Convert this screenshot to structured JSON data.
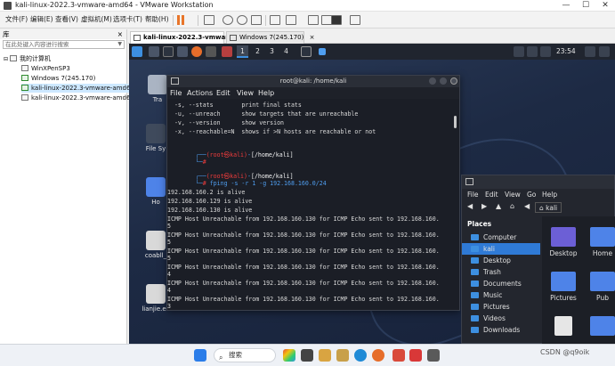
{
  "window": {
    "title": "kali-linux-2022.3-vmware-amd64 - VMware Workstation",
    "minimize": "—",
    "maximize": "☐",
    "close": "✕"
  },
  "menubar": [
    "文件(F)",
    "编辑(E)",
    "查看(V)",
    "虚拟机(M)",
    "选项卡(T)",
    "帮助(H)"
  ],
  "library": {
    "header": "库",
    "close": "×",
    "search_placeholder": "在此处键入内容进行搜索",
    "root": "我的计算机",
    "vms": [
      {
        "name": "WinXPenSP3",
        "running": false
      },
      {
        "name": "Windows 7(245.170)",
        "running": true
      },
      {
        "name": "kali-linux-2022.3-vmware-amd64",
        "running": true,
        "selected": true
      },
      {
        "name": "kali-linux-2022.3-vmware-amd64",
        "running": false
      }
    ]
  },
  "tabs": [
    {
      "label": "kali-linux-2022.3-vmwar...",
      "close": "×",
      "active": true
    },
    {
      "label": "Windows 7(245.170)",
      "close": "×",
      "active": false
    }
  ],
  "kali_panel": {
    "workspaces": [
      "1",
      "2",
      "3",
      "4"
    ],
    "active_workspace": "1",
    "clock": "23:54"
  },
  "desktop_icons": [
    "Tra",
    "File Sy",
    "Ho",
    "coabll_",
    "lianjie.ex"
  ],
  "terminal": {
    "title": "root@kali: /home/kali",
    "menu": [
      "File",
      "Actions",
      "Edit",
      "View",
      "Help"
    ],
    "lines": [
      "  -s, --stats        print final stats",
      "  -u, --unreach      show targets that are unreachable",
      "  -v, --version      show version",
      "  -x, --reachable=N  shows if >N hosts are reachable or not",
      "",
      "",
      "",
      "",
      "",
      "192.168.160.2 is alive",
      "192.168.160.129 is alive",
      "192.168.160.130 is alive",
      "ICMP Host Unreachable from 192.168.160.130 for ICMP Echo sent to 192.168.160.",
      "5",
      "ICMP Host Unreachable from 192.168.160.130 for ICMP Echo sent to 192.168.160.",
      "5",
      "ICMP Host Unreachable from 192.168.160.130 for ICMP Echo sent to 192.168.160.",
      "5",
      "ICMP Host Unreachable from 192.168.160.130 for ICMP Echo sent to 192.168.160.",
      "4",
      "ICMP Host Unreachable from 192.168.160.130 for ICMP Echo sent to 192.168.160.",
      "4",
      "ICMP Host Unreachable from 192.168.160.130 for ICMP Echo sent to 192.168.160.",
      "3",
      "ICMP Host Unreachable from 192.168.160.130 for ICMP Echo sent to 192.168.160.",
      "3",
      "ICMP Host Unreachable from 192.168.160.130 for ICMP Echo sent to 192.168.160."
    ],
    "prompt1": {
      "user": "(root㉿kali)",
      "path": "[/home/kali]",
      "hash": "#"
    },
    "prompt2": {
      "user": "(root㉿kali)",
      "path": "[/home/kali]",
      "hash": "#",
      "command": "fping -s -r 1 -g 192.168.160.0/24"
    }
  },
  "filemanager": {
    "menu": [
      "File",
      "Edit",
      "View",
      "Go",
      "Help"
    ],
    "nav": [
      "◀",
      "▶",
      "▲",
      "◀"
    ],
    "path": "kali",
    "home": "⌂",
    "places_header": "Places",
    "places": [
      "Computer",
      "kali",
      "Desktop",
      "Trash",
      "Documents",
      "Music",
      "Pictures",
      "Videos",
      "Downloads"
    ],
    "selected_place": "kali",
    "folders": [
      "Desktop",
      "Home",
      "Pictures",
      "Pub",
      "",
      ""
    ]
  },
  "taskbar": {
    "search_label": "搜索"
  },
  "watermark": "CSDN @q9oik",
  "colors": {
    "kali_accent": "#2f7ad6",
    "prompt_red": "#ee3c3c",
    "prompt_blue": "#4f9ef0"
  }
}
